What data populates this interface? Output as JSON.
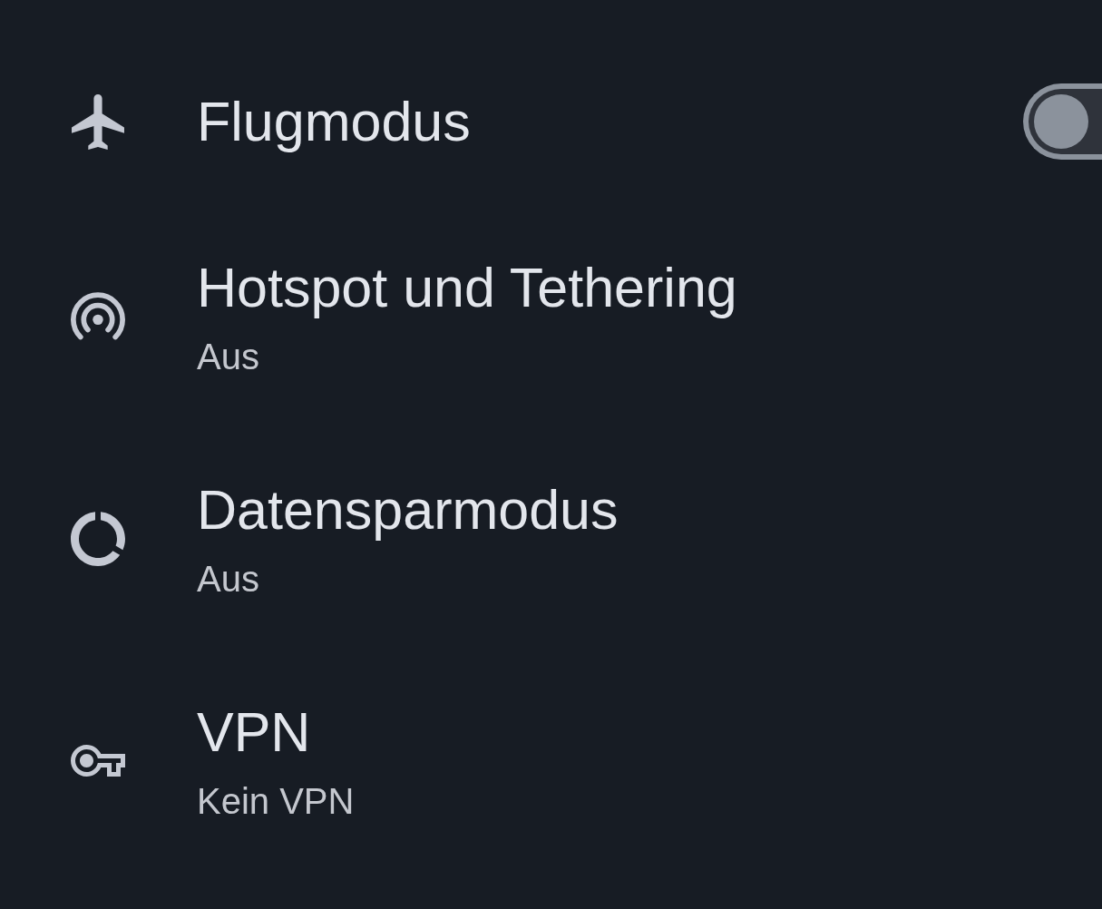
{
  "settings": [
    {
      "kind": "switch",
      "title": "Flugmodus",
      "on": false
    },
    {
      "kind": "text",
      "title": "Hotspot und Tethering",
      "summary": "Aus"
    },
    {
      "kind": "text",
      "title": "Datensparmodus",
      "summary": "Aus"
    },
    {
      "kind": "text",
      "title": "VPN",
      "summary": "Kein VPN"
    }
  ]
}
